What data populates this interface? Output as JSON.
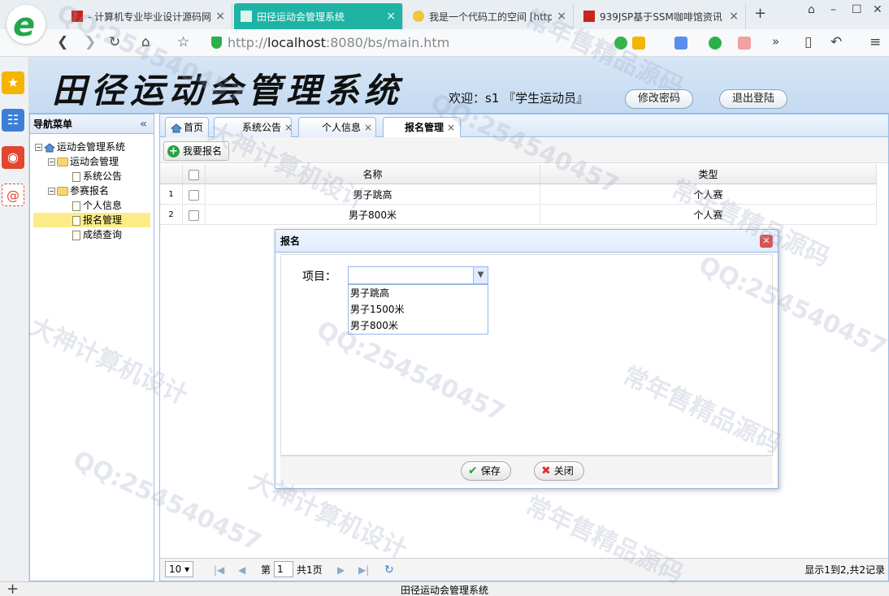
{
  "browser": {
    "tabs": [
      {
        "label": "- 计算机专业毕业设计源码网",
        "close": "×"
      },
      {
        "label": "田径运动会管理系统",
        "close": "×"
      },
      {
        "label": "我是一个代码工的空间 [http",
        "close": "×"
      },
      {
        "label": "939JSP基于SSM咖啡馆资讯",
        "close": "×"
      }
    ],
    "new_tab": "+",
    "url_prefix": "http://",
    "url_host": "localhost",
    "url_rest": ":8080/bs/main.htm",
    "colors": {
      "active_tab": "#1fb3a4",
      "shield": "#2bb14b"
    }
  },
  "app": {
    "title": "田径运动会管理系统",
    "welcome": "欢迎：s1 『学生运动员』",
    "change_password": "修改密码",
    "logout": "退出登陆"
  },
  "nav": {
    "title": "导航菜单",
    "collapse": "«",
    "root": "运动会管理系统",
    "groups": [
      {
        "label": "运动会管理",
        "items": [
          "系统公告"
        ]
      },
      {
        "label": "参赛报名",
        "items": [
          "个人信息",
          "报名管理",
          "成绩查询"
        ]
      }
    ],
    "selected": "报名管理"
  },
  "main_tabs": [
    {
      "label": "首页"
    },
    {
      "label": "系统公告",
      "close": "×"
    },
    {
      "label": "个人信息",
      "close": "×"
    },
    {
      "label": "报名管理",
      "close": "×"
    }
  ],
  "toolbar": {
    "add_label": "我要报名"
  },
  "grid": {
    "columns": [
      "名称",
      "类型"
    ],
    "rows": [
      {
        "num": "1",
        "name": "男子跳高",
        "type": "个人赛"
      },
      {
        "num": "2",
        "name": "男子800米",
        "type": "个人赛"
      }
    ]
  },
  "pager": {
    "page_size": "10",
    "page_prefix": "第",
    "page": "1",
    "page_total": "共1页",
    "summary": "显示1到2,共2记录"
  },
  "dialog": {
    "title": "报名",
    "field_label": "项目：",
    "select_value": "",
    "options": [
      "男子跳高",
      "男子1500米",
      "男子800米"
    ],
    "save_label": "保存",
    "close_label": "关闭"
  },
  "status": {
    "text": "田径运动会管理系统"
  },
  "watermarks": [
    "QQ:254540457",
    "常年售精品源码",
    "大神计算机设计",
    "QQ:254540457",
    "常年售精品源码",
    "大神计算机设计",
    "QQ:254540457",
    "常年售精品源码",
    "QQ:254540457",
    "大神计算机设计",
    "常年售精品源码",
    "QQ:254540457"
  ]
}
